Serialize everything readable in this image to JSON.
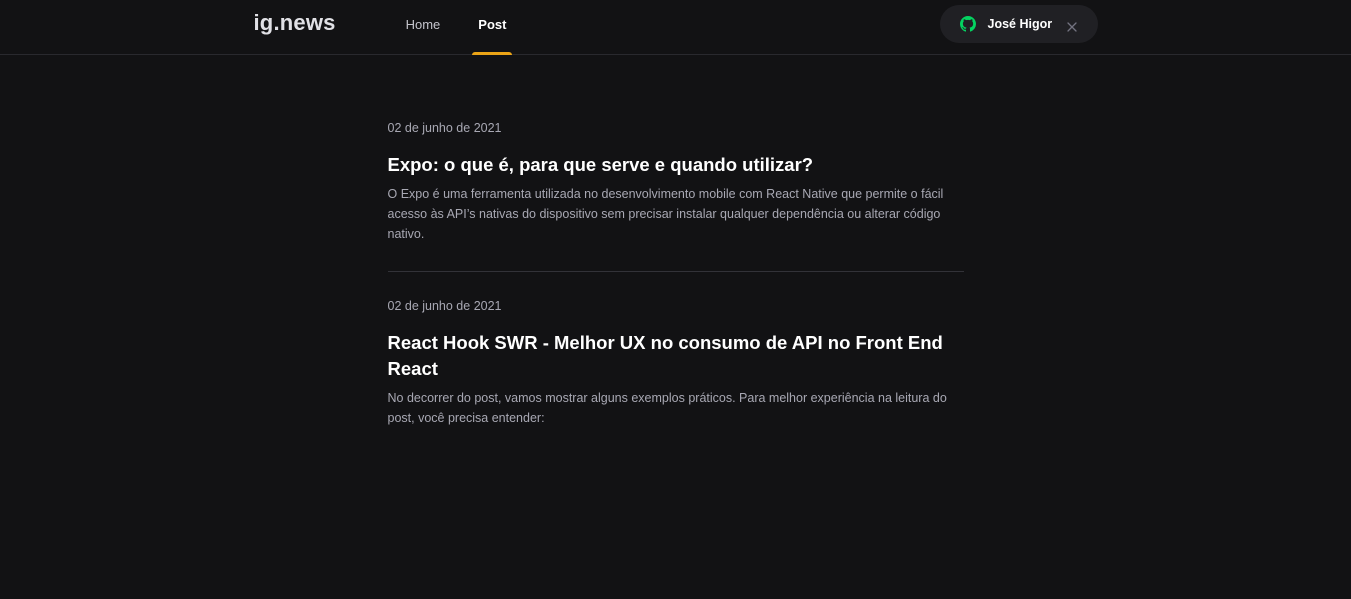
{
  "brand": {
    "logo": "ig.news"
  },
  "nav": {
    "items": [
      {
        "label": "Home",
        "active": false
      },
      {
        "label": "Post",
        "active": true
      }
    ]
  },
  "user": {
    "name": "José Higor",
    "icon": "github-icon",
    "icon_color": "#04d361"
  },
  "colors": {
    "accent": "#eba417",
    "background": "#121214"
  },
  "posts": [
    {
      "date": "02 de junho de 2021",
      "title": "Expo: o que é, para que serve e quando utilizar?",
      "excerpt": "O Expo é uma ferramenta utilizada no desenvolvimento mobile com React Native que permite o fácil acesso às API’s nativas do dispositivo sem precisar instalar qualquer dependência ou alterar código nativo."
    },
    {
      "date": "02 de junho de 2021",
      "title": "React Hook SWR - Melhor UX no consumo de API no Front End React",
      "excerpt": "No decorrer do post, vamos mostrar alguns exemplos práticos. Para melhor experiência na leitura do post, você precisa entender:"
    }
  ]
}
